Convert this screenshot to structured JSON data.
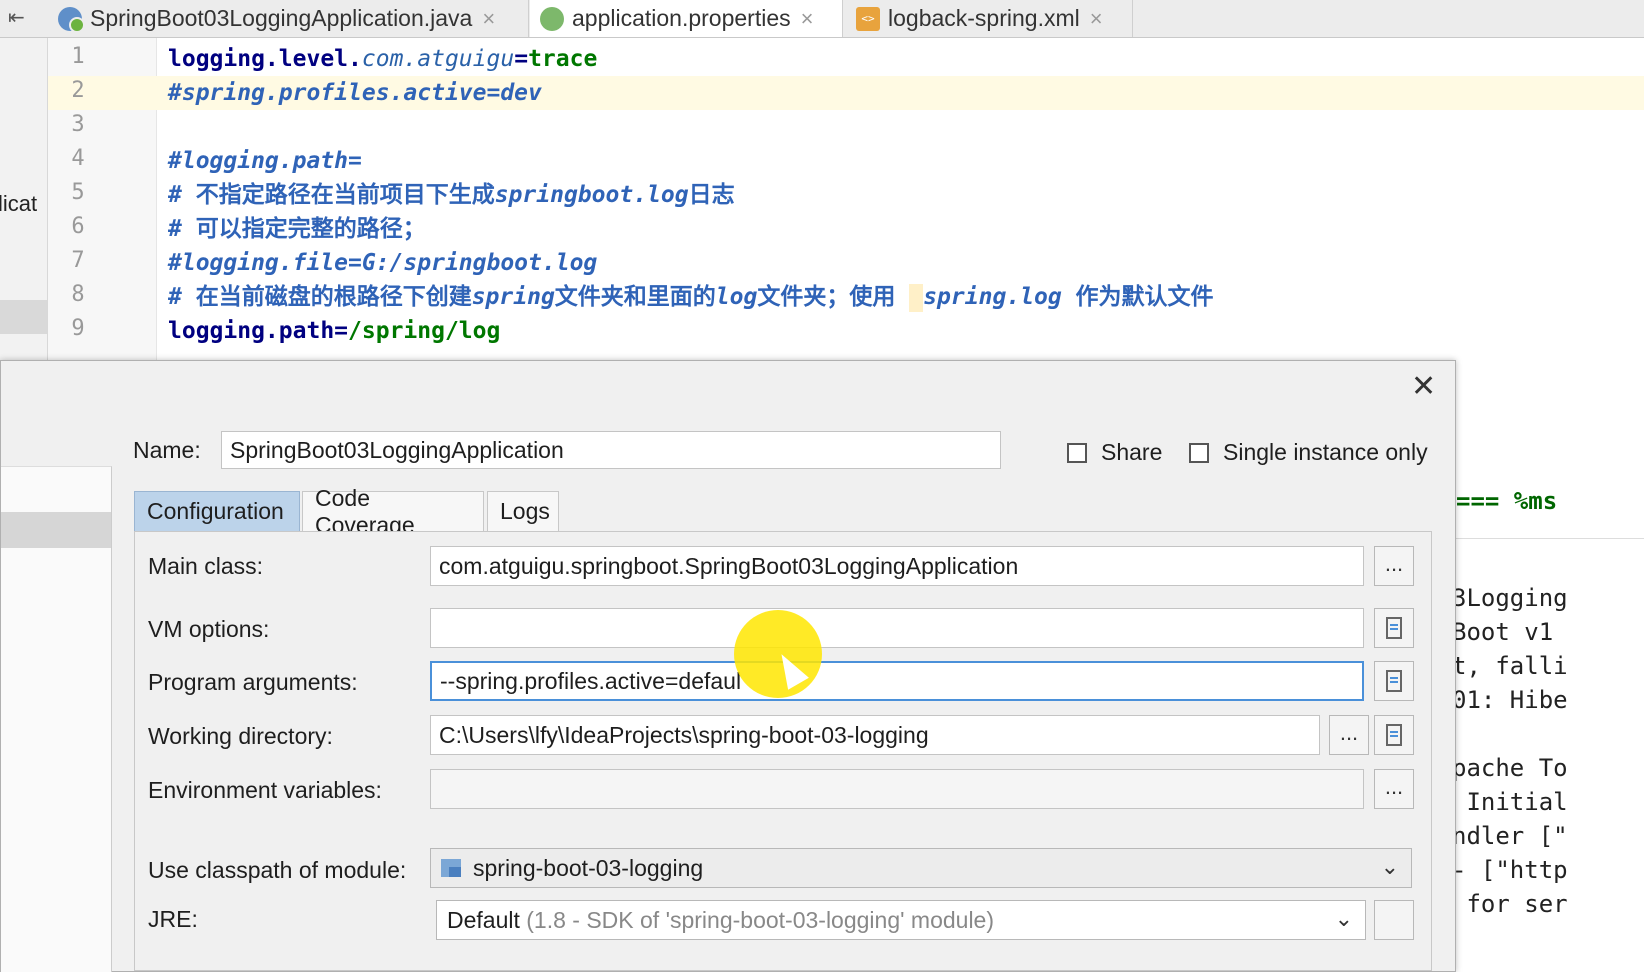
{
  "tabs": [
    {
      "label": "SpringBoot03LoggingApplication.java",
      "icon": "java-class-icon"
    },
    {
      "label": "application.properties",
      "icon": "properties-file-icon"
    },
    {
      "label": "logback-spring.xml",
      "icon": "xml-file-icon"
    }
  ],
  "editor": {
    "line_numbers": [
      "1",
      "2",
      "3",
      "4",
      "5",
      "6",
      "7",
      "8",
      "9"
    ],
    "side_text": "licat",
    "line1": {
      "key": "logging.level.",
      "pkg": "com.atguigu",
      "eq": "=",
      "val": "trace"
    },
    "line2": "#spring.profiles.active=dev",
    "line4": "#logging.path=",
    "line5": {
      "a": "# 不指定路径在当前项目下生成",
      "b": "springboot.log",
      "c": "日志"
    },
    "line6": "# 可以指定完整的路径；",
    "line7": "#logging.file=G:/springboot.log",
    "line8": {
      "a": "# 在当前磁盘的根路径下创建",
      "b": "spring",
      "c": "文件夹和里面的",
      "d": "log",
      "e": "文件夹；使用 ",
      "f": "spring.log",
      "g": " 作为默认文件"
    },
    "line9": {
      "key": "logging.path",
      "eq": "=",
      "val": "/spring/log"
    }
  },
  "background_console": {
    "xml_snippet": "=== %ms",
    "lines": [
      "3Logging",
      "Boot v1",
      "t, falli",
      "01: Hibe",
      "",
      "pache To",
      " Initial",
      "ndler [\"",
      "- [\"http",
      " for ser"
    ]
  },
  "dialog": {
    "name_label": "Name:",
    "name_value": "SpringBoot03LoggingApplication",
    "share_label": "Share",
    "single_instance_label": "Single instance only",
    "tabs": [
      "Configuration",
      "Code Coverage",
      "Logs"
    ],
    "fields": {
      "main_class": {
        "label": "Main class:",
        "value": "com.atguigu.springboot.SpringBoot03LoggingApplication"
      },
      "vm_options": {
        "label": "VM options:",
        "value": ""
      },
      "program_arguments": {
        "label": "Program arguments:",
        "value": "--spring.profiles.active=defaul"
      },
      "working_directory": {
        "label": "Working directory:",
        "value": "C:\\Users\\lfy\\IdeaProjects\\spring-boot-03-logging"
      },
      "environment_variables": {
        "label": "Environment variables:",
        "value": ""
      },
      "classpath_module": {
        "label": "Use classpath of module:",
        "value": "spring-boot-03-logging"
      },
      "jre": {
        "label": "JRE:",
        "value": "Default",
        "hint": "(1.8 - SDK of 'spring-boot-03-logging' module)"
      }
    },
    "browse_label": "..."
  }
}
